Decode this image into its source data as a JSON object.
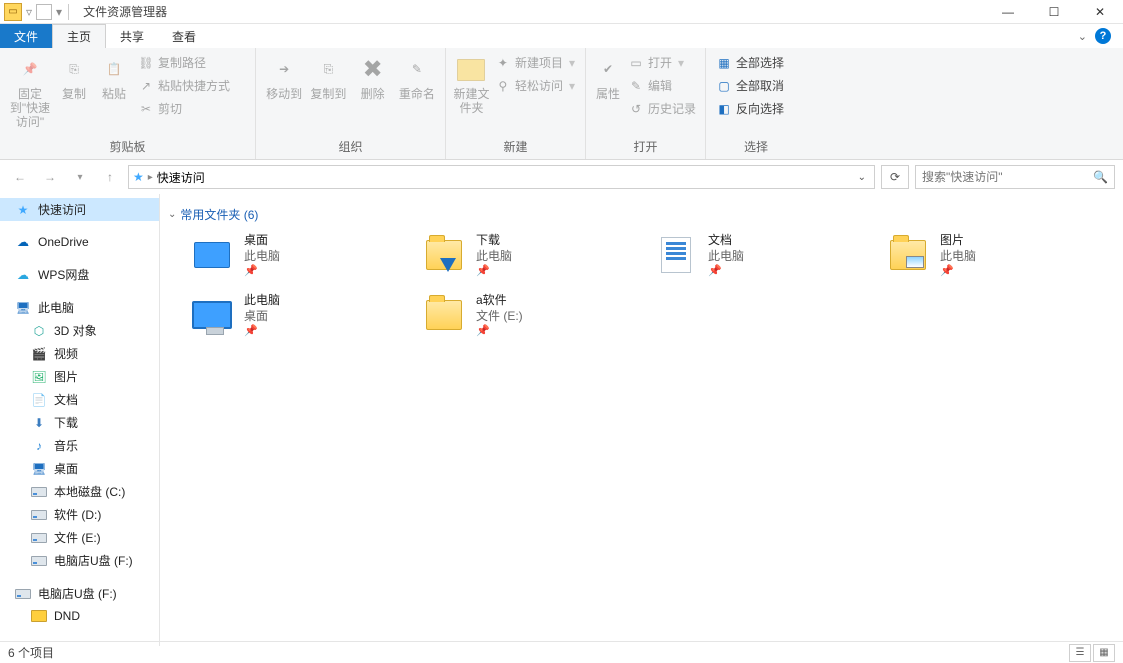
{
  "window": {
    "title": "文件资源管理器"
  },
  "tabs": {
    "file": "文件",
    "home": "主页",
    "share": "共享",
    "view": "查看"
  },
  "ribbon": {
    "clipboard": {
      "pin": "固定到\"快速访问\"",
      "copy": "复制",
      "paste": "粘贴",
      "copy_path": "复制路径",
      "paste_shortcut": "粘贴快捷方式",
      "cut": "剪切",
      "label": "剪贴板"
    },
    "organize": {
      "move_to": "移动到",
      "copy_to": "复制到",
      "delete": "删除",
      "rename": "重命名",
      "label": "组织"
    },
    "new": {
      "new_folder": "新建文件夹",
      "new_item": "新建项目",
      "easy_access": "轻松访问",
      "label": "新建"
    },
    "open": {
      "properties": "属性",
      "open": "打开",
      "edit": "编辑",
      "history": "历史记录",
      "label": "打开"
    },
    "select": {
      "select_all": "全部选择",
      "select_none": "全部取消",
      "invert": "反向选择",
      "label": "选择"
    }
  },
  "nav": {
    "crumb": "快速访问",
    "search_placeholder": "搜索\"快速访问\""
  },
  "tree": {
    "quick_access": "快速访问",
    "onedrive": "OneDrive",
    "wps": "WPS网盘",
    "this_pc": "此电脑",
    "objects3d": "3D 对象",
    "videos": "视频",
    "pictures": "图片",
    "documents": "文档",
    "downloads": "下载",
    "music": "音乐",
    "desktop": "桌面",
    "drive_c": "本地磁盘 (C:)",
    "drive_d": "软件 (D:)",
    "drive_e": "文件 (E:)",
    "drive_f": "电脑店U盘 (F:)",
    "drive_f2": "电脑店U盘 (F:)",
    "dnd": "DND"
  },
  "content": {
    "group_header": "常用文件夹 (6)",
    "items": [
      {
        "name": "桌面",
        "sub": "此电脑",
        "pinned": true,
        "icon": "desktop"
      },
      {
        "name": "下载",
        "sub": "此电脑",
        "pinned": true,
        "icon": "downloads"
      },
      {
        "name": "文档",
        "sub": "此电脑",
        "pinned": true,
        "icon": "documents"
      },
      {
        "name": "图片",
        "sub": "此电脑",
        "pinned": true,
        "icon": "pictures"
      },
      {
        "name": "此电脑",
        "sub": "桌面",
        "pinned": true,
        "icon": "pc"
      },
      {
        "name": "a软件",
        "sub": "文件 (E:)",
        "pinned": true,
        "icon": "folder"
      }
    ]
  },
  "status": {
    "count": "6 个项目"
  }
}
